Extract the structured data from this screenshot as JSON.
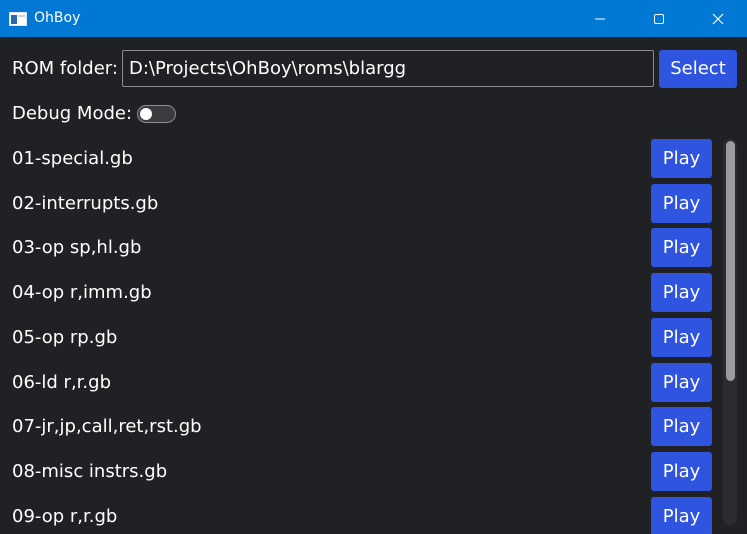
{
  "window": {
    "title": "OhBoy",
    "accent_color": "#0078d4",
    "controls": [
      "minimize-icon",
      "maximize-icon",
      "close-icon"
    ]
  },
  "rom_folder": {
    "label": "ROM folder:",
    "value": "D:\\Projects\\OhBoy\\roms\\blargg",
    "select_label": "Select"
  },
  "debug": {
    "label": "Debug Mode:",
    "enabled": false
  },
  "roms": [
    {
      "name": "01-special.gb",
      "play_label": "Play"
    },
    {
      "name": "02-interrupts.gb",
      "play_label": "Play"
    },
    {
      "name": "03-op sp,hl.gb",
      "play_label": "Play"
    },
    {
      "name": "04-op r,imm.gb",
      "play_label": "Play"
    },
    {
      "name": "05-op rp.gb",
      "play_label": "Play"
    },
    {
      "name": "06-ld r,r.gb",
      "play_label": "Play"
    },
    {
      "name": "07-jr,jp,call,ret,rst.gb",
      "play_label": "Play"
    },
    {
      "name": "08-misc instrs.gb",
      "play_label": "Play"
    },
    {
      "name": "09-op r,r.gb",
      "play_label": "Play"
    }
  ],
  "colors": {
    "background": "#202125",
    "button": "#2f54e0",
    "text": "#ffffff"
  }
}
